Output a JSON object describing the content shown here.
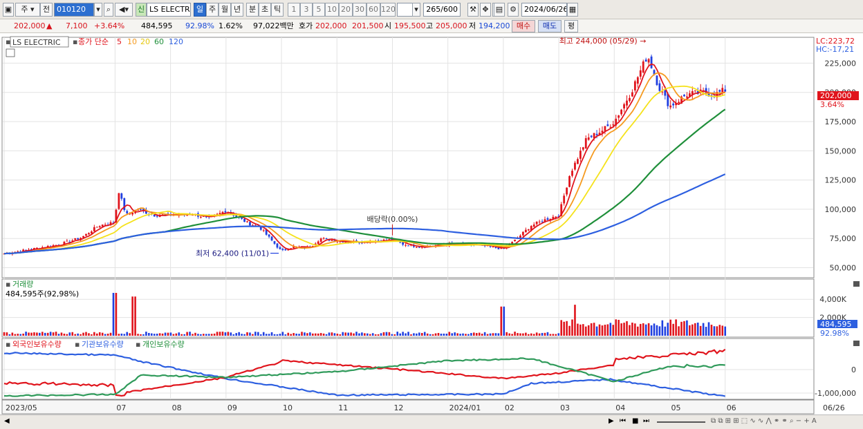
{
  "toolbar": {
    "period_select": "주",
    "prev_label": "전",
    "stock_code": "010120",
    "new_badge": "신",
    "stock_name": "LS ELECTRI",
    "period_tabs": [
      "일",
      "주",
      "월",
      "년",
      "분",
      "초",
      "틱"
    ],
    "period_selected": "일",
    "interval_tabs": [
      "1",
      "3",
      "5",
      "10",
      "20",
      "30",
      "60",
      "120"
    ],
    "count_value": "265",
    "count_max": "/600",
    "date_value": "2024/06/26"
  },
  "quote": {
    "price": "202,000",
    "change_arrow": "▲",
    "change": "7,100",
    "change_pct": "+3.64%",
    "volume": "484,595",
    "volume_ratio": "92.98%",
    "turnover": "1.62%",
    "amount": "97,022백만",
    "ask_label": "호가",
    "ask1": "202,000",
    "ask2": "201,500",
    "open_label": "시",
    "open": "195,500",
    "high_label": "고",
    "high": "205,000",
    "low_label": "저",
    "low": "194,200",
    "buy_label": "매수",
    "sell_label": "매도",
    "eval_label": "평"
  },
  "legend": {
    "stock": "LS ELECTRIC",
    "ma_label": "종가 단순",
    "ma_periods": [
      "5",
      "10",
      "20",
      "60",
      "120"
    ],
    "lc": "LC:223,72",
    "hc": "HC:-17,21",
    "volume_title": "거래량",
    "volume_value": "484,595주(92,98%)",
    "flow_titles": [
      "외국인보유수량",
      "기관보유수량",
      "개인보유수량"
    ]
  },
  "colors": {
    "up": "#e0141c",
    "down": "#1f3fe0",
    "ma5": "#e0141c",
    "ma10": "#f59a1f",
    "ma20": "#f5e21c",
    "ma60": "#1f8f3a",
    "ma120": "#2d5fe0",
    "foreign": "#2d5fe0",
    "institution": "#e0141c",
    "individual": "#2f9a5a"
  },
  "chart_data": [
    {
      "type": "candlestick",
      "title": "LS ELECTRIC",
      "ylabel": "",
      "y_ticks": [
        "225,000",
        "200,000",
        "175,000",
        "150,000",
        "125,000",
        "100,000",
        "75,000",
        "50,000"
      ],
      "ylim": [
        45000,
        240000
      ],
      "x_tick_labels": [
        "2023/05",
        "07",
        "08",
        "09",
        "10",
        "11",
        "12",
        "2024/01",
        "02",
        "03",
        "04",
        "05",
        "06",
        "06/26"
      ],
      "x_ticks_month_index": [
        0,
        2,
        3,
        4,
        5,
        6,
        7,
        8,
        9,
        10,
        11,
        12,
        13
      ],
      "months": 14,
      "close_path": [
        [
          0,
          62000
        ],
        [
          0.5,
          66000
        ],
        [
          1,
          70000
        ],
        [
          1.4,
          76000
        ],
        [
          1.7,
          86000
        ],
        [
          2.0,
          89000
        ],
        [
          2.05,
          118000
        ],
        [
          2.2,
          95000
        ],
        [
          2.4,
          100000
        ],
        [
          2.7,
          95000
        ],
        [
          3.0,
          95000
        ],
        [
          3.4,
          96000
        ],
        [
          3.7,
          92000
        ],
        [
          4.0,
          99000
        ],
        [
          4.4,
          88000
        ],
        [
          4.6,
          85000
        ],
        [
          5.0,
          64000
        ],
        [
          5.2,
          68000
        ],
        [
          5.5,
          67000
        ],
        [
          5.7,
          75000
        ],
        [
          6.0,
          73000
        ],
        [
          6.4,
          72000
        ],
        [
          7.0,
          74000
        ],
        [
          7.2,
          70000
        ],
        [
          7.5,
          68000
        ],
        [
          8.0,
          70000
        ],
        [
          8.6,
          69000
        ],
        [
          9.0,
          66000
        ],
        [
          9.2,
          73000
        ],
        [
          9.5,
          86000
        ],
        [
          9.8,
          92000
        ],
        [
          10.0,
          95000
        ],
        [
          10.2,
          130000
        ],
        [
          10.5,
          160000
        ],
        [
          10.8,
          168000
        ],
        [
          11.0,
          175000
        ],
        [
          11.3,
          200000
        ],
        [
          11.6,
          232000
        ],
        [
          11.8,
          205000
        ],
        [
          12.0,
          188000
        ],
        [
          12.3,
          198000
        ],
        [
          12.6,
          200000
        ],
        [
          12.8,
          198000
        ],
        [
          13.0,
          202000
        ]
      ],
      "series": [
        {
          "name": "5",
          "values": []
        },
        {
          "name": "10",
          "values": []
        },
        {
          "name": "20",
          "values": []
        },
        {
          "name": "60",
          "values": []
        },
        {
          "name": "120",
          "values": []
        }
      ],
      "annotations": [
        {
          "text": "최고 244,000 (05/29)",
          "month": 11.65,
          "value": 244000
        },
        {
          "text": "최저 62,400 (11/01)",
          "month": 5.0,
          "value": 62400
        },
        {
          "text": "배당락(0.00%)",
          "month": 7.0,
          "value": 80000
        }
      ],
      "last_price_label": "202,000",
      "last_change_label": "3.64%"
    },
    {
      "type": "bar",
      "title": "거래량",
      "y_ticks": [
        "4,000K",
        "2,000K"
      ],
      "ylim": [
        0,
        5000000
      ],
      "last_value_label": "484,595",
      "last_ratio_label": "92.98%",
      "spikes": [
        {
          "month": 2.0,
          "value": 4700000
        },
        {
          "month": 2.35,
          "value": 4300000
        },
        {
          "month": 9.0,
          "value": 3200000
        },
        {
          "month": 10.3,
          "value": 3400000
        }
      ]
    },
    {
      "type": "line",
      "title": "보유수량",
      "y_ticks": [
        "0",
        "-1,000,000"
      ],
      "series": [
        {
          "name": "외국인보유수량",
          "values": []
        },
        {
          "name": "기관보유수량",
          "values": []
        },
        {
          "name": "개인보유수량",
          "values": []
        }
      ]
    }
  ]
}
